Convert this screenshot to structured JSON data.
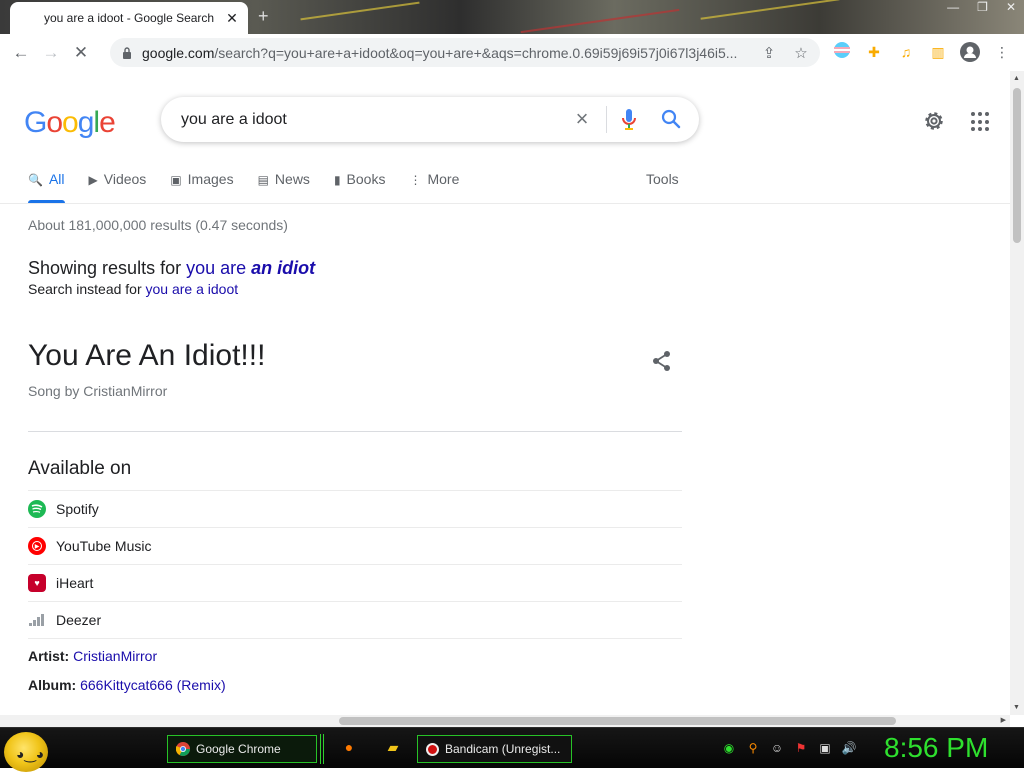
{
  "browser": {
    "tab_title": "you are a idoot - Google Search",
    "url_host": "google.com",
    "url_rest": "/search?q=you+are+a+idoot&oq=you+are+&aqs=chrome.0.69i59j69i57j0i67l3j46i5...",
    "new_tab_symbol": "+",
    "close_symbol": "✕"
  },
  "google": {
    "logo_letters": [
      {
        "ch": "G",
        "color": "#4285f4"
      },
      {
        "ch": "o",
        "color": "#ea4335"
      },
      {
        "ch": "o",
        "color": "#fbbc05"
      },
      {
        "ch": "g",
        "color": "#4285f4"
      },
      {
        "ch": "l",
        "color": "#34a853"
      },
      {
        "ch": "e",
        "color": "#ea4335"
      }
    ],
    "query": "you are a idoot",
    "tabs": [
      {
        "label": "All",
        "icon": "search-icon",
        "glyph": "🔍"
      },
      {
        "label": "Videos",
        "icon": "video-icon",
        "glyph": "▶"
      },
      {
        "label": "Images",
        "icon": "image-icon",
        "glyph": "▣"
      },
      {
        "label": "News",
        "icon": "news-icon",
        "glyph": "▤"
      },
      {
        "label": "Books",
        "icon": "book-icon",
        "glyph": "▮"
      },
      {
        "label": "More",
        "icon": "more-icon",
        "glyph": "⋮"
      }
    ],
    "tools_label": "Tools",
    "stats": "About 181,000,000 results (0.47 seconds)",
    "showing_prefix": "Showing results for ",
    "showing_plain": "you are ",
    "showing_corrected": "an idiot",
    "instead_prefix": "Search instead for ",
    "instead_link": "you are a idoot"
  },
  "knowledge_panel": {
    "title": "You Are An Idiot!!!",
    "subtitle": "Song by CristianMirror",
    "available_heading": "Available on",
    "providers": [
      {
        "name": "Spotify",
        "icon": "spotify-icon",
        "color": "#1db954"
      },
      {
        "name": "YouTube Music",
        "icon": "youtube-music-icon",
        "color": "#ff0000"
      },
      {
        "name": "iHeart",
        "icon": "iheart-icon",
        "color": "#c6002b"
      },
      {
        "name": "Deezer",
        "icon": "deezer-icon",
        "color": "#9aa0a6"
      }
    ],
    "artist_label": "Artist:",
    "artist_value": "CristianMirror",
    "album_label": "Album:",
    "album_value": "666Kittycat666 (Remix)"
  },
  "taskbar": {
    "chrome_label": "Google Chrome",
    "bandicam_label": "Bandicam (Unregist...",
    "clock": "8:56 PM",
    "accent": "#2ee02e"
  }
}
